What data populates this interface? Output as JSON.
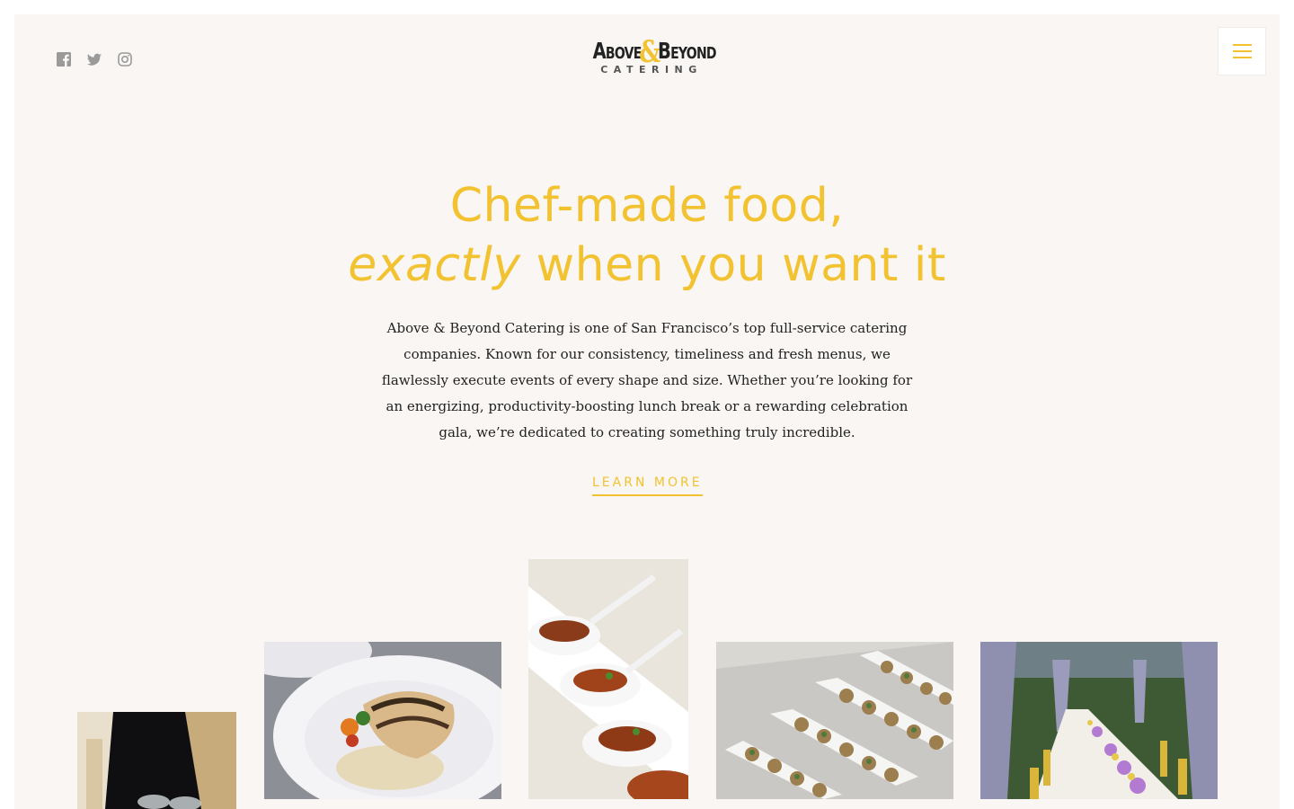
{
  "brand": {
    "name_left": "Above",
    "ampersand": "&",
    "name_right": "Beyond",
    "tagline": "CATERING"
  },
  "social": [
    {
      "icon": "facebook-icon"
    },
    {
      "icon": "twitter-icon"
    },
    {
      "icon": "instagram-icon"
    }
  ],
  "menu": {
    "icon": "hamburger-menu-icon"
  },
  "hero": {
    "title_line1": "Chef-made food,",
    "title_line2_italic": "exactly",
    "title_line2_rest": " when you want it",
    "body": "Above & Beyond Catering is one of San Francisco’s top full-service catering companies. Known for our consistency, timeliness and fresh menus, we flawlessly execute events of every shape and size. Whether you’re looking for an energizing, productivity-boosting lunch break or a rewarding celebration gala, we’re dedicated to creating something truly incredible.",
    "cta": "LEARN MORE"
  },
  "colors": {
    "accent": "#f2c230",
    "background": "#f9f6f3",
    "text": "#222222",
    "icon": "#9a9a9a"
  },
  "gallery": [
    {
      "subject": "server-holding-glasses-photo"
    },
    {
      "subject": "grilled-fish-plate-photo"
    },
    {
      "subject": "shrimp-spoons-photo"
    },
    {
      "subject": "canape-platters-photo"
    },
    {
      "subject": "garden-banquet-table-photo"
    }
  ]
}
